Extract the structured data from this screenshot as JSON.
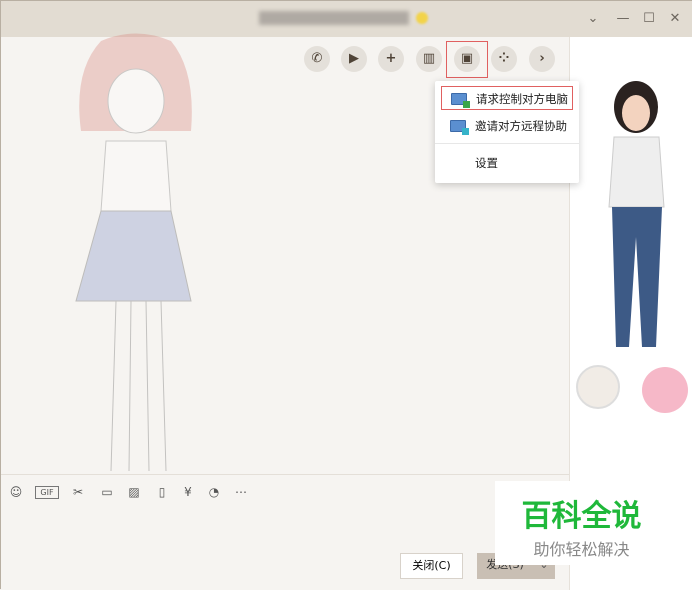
{
  "toolbar": {
    "icons": [
      "phone-icon",
      "video-icon",
      "add-chat-icon",
      "screen-share-icon",
      "remote-desktop-icon",
      "apps-icon",
      "more-arrow-icon"
    ]
  },
  "menu": {
    "items": [
      {
        "label": "请求控制对方电脑"
      },
      {
        "label": "邀请对方远程协助"
      },
      {
        "label": "设置"
      }
    ]
  },
  "input_toolbar": {
    "icons": [
      "emoji-icon",
      "gif-icon",
      "scissors-icon",
      "folder-icon",
      "image-icon",
      "shake-icon",
      "red-packet-icon",
      "music-icon",
      "more-icon"
    ],
    "gif_label": "GIF"
  },
  "buttons": {
    "close": "关闭(C)",
    "send": "发送(S)"
  },
  "watermark": {
    "title": "百科全说",
    "subtitle": "助你轻松解决"
  },
  "colors": {
    "accent": "#1fb83a",
    "highlight": "#e06060"
  }
}
